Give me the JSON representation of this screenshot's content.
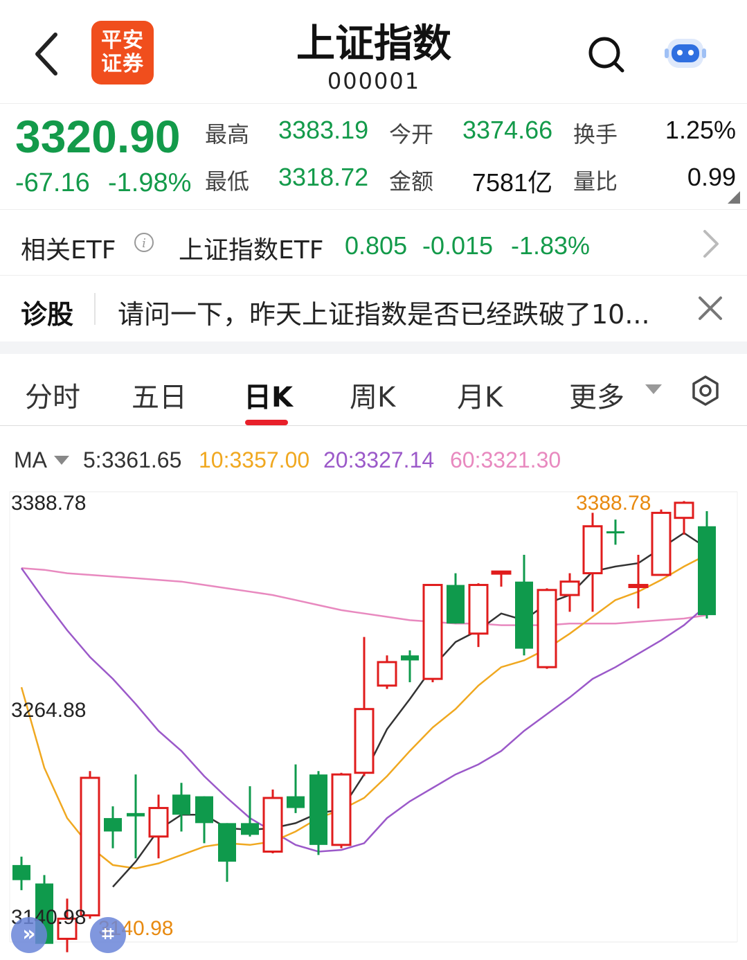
{
  "header": {
    "title": "上证指数",
    "code": "000001",
    "logo_line1": "平安",
    "logo_line2": "证券"
  },
  "quote": {
    "price": "3320.90",
    "change": "-67.16",
    "change_pct": "-1.98%",
    "fields": [
      {
        "label": "最高",
        "value": "3383.19"
      },
      {
        "label": "今开",
        "value": "3374.66"
      },
      {
        "label": "换手",
        "value": "1.25%"
      },
      {
        "label": "最低",
        "value": "3318.72"
      },
      {
        "label": "金额",
        "value": "7581亿"
      },
      {
        "label": "量比",
        "value": "0.99"
      }
    ]
  },
  "etf": {
    "label": "相关ETF",
    "name": "上证指数ETF",
    "price": "0.805",
    "change": "-0.015",
    "change_pct": "-1.83%"
  },
  "diagnose": {
    "label": "诊股",
    "text": "请问一下，昨天上证指数是否已经跌破了10..."
  },
  "tabs": [
    "分时",
    "五日",
    "日K",
    "周K",
    "月K",
    "更多"
  ],
  "active_tab": "日K",
  "ma": {
    "label": "MA",
    "ma5": "5:3361.65",
    "ma10": "10:3357.00",
    "ma20": "20:3327.14",
    "ma60": "60:3321.30"
  },
  "colors": {
    "up": "#e01c1c",
    "down": "#0f9a4c",
    "ma5": "#333333",
    "ma10": "#f0a820",
    "ma20": "#9b59c9",
    "ma60": "#e889bf",
    "accent": "#e8202a"
  },
  "chart_data": {
    "type": "candlestick",
    "y_axis_labels": [
      "3388.78",
      "3264.88",
      "3140.98"
    ],
    "ylim": [
      3140.98,
      3388.78
    ],
    "max_label": "3388.78",
    "min_label": "3140.98",
    "candles": [
      {
        "o": 3172,
        "c": 3163,
        "h": 3177,
        "l": 3157
      },
      {
        "o": 3161,
        "c": 3125,
        "h": 3166,
        "l": 3125
      },
      {
        "o": 3128,
        "c": 3140,
        "h": 3152,
        "l": 3120
      },
      {
        "o": 3142,
        "c": 3224,
        "h": 3228,
        "l": 3140
      },
      {
        "o": 3200,
        "c": 3192,
        "h": 3207,
        "l": 3182
      },
      {
        "o": 3203,
        "c": 3201,
        "h": 3226,
        "l": 3176
      },
      {
        "o": 3189,
        "c": 3206,
        "h": 3214,
        "l": 3176
      },
      {
        "o": 3214,
        "c": 3202,
        "h": 3221,
        "l": 3192
      },
      {
        "o": 3213,
        "c": 3197,
        "h": 3213,
        "l": 3185
      },
      {
        "o": 3197,
        "c": 3174,
        "h": 3197,
        "l": 3162
      },
      {
        "o": 3197,
        "c": 3190,
        "h": 3219,
        "l": 3189
      },
      {
        "o": 3180,
        "c": 3212,
        "h": 3217,
        "l": 3179
      },
      {
        "o": 3213,
        "c": 3206,
        "h": 3232,
        "l": 3203
      },
      {
        "o": 3226,
        "c": 3184,
        "h": 3228,
        "l": 3178
      },
      {
        "o": 3184,
        "c": 3226,
        "h": 3227,
        "l": 3182
      },
      {
        "o": 3227,
        "c": 3265,
        "h": 3308,
        "l": 3225
      },
      {
        "o": 3279,
        "c": 3293,
        "h": 3297,
        "l": 3277
      },
      {
        "o": 3297,
        "c": 3294,
        "h": 3300,
        "l": 3281
      },
      {
        "o": 3283,
        "c": 3339,
        "h": 3339,
        "l": 3281
      },
      {
        "o": 3339,
        "c": 3316,
        "h": 3346,
        "l": 3316
      },
      {
        "o": 3310,
        "c": 3339,
        "h": 3340,
        "l": 3302
      },
      {
        "o": 3346,
        "c": 3347,
        "h": 3347,
        "l": 3338
      },
      {
        "o": 3341,
        "c": 3301,
        "h": 3357,
        "l": 3297
      },
      {
        "o": 3290,
        "c": 3336,
        "h": 3337,
        "l": 3289
      },
      {
        "o": 3333,
        "c": 3341,
        "h": 3346,
        "l": 3323
      },
      {
        "o": 3346,
        "c": 3374,
        "h": 3382,
        "l": 3323
      },
      {
        "o": 3371,
        "c": 3370,
        "h": 3378,
        "l": 3363
      },
      {
        "o": 3338,
        "c": 3339,
        "h": 3357,
        "l": 3325
      },
      {
        "o": 3345,
        "c": 3382,
        "h": 3384,
        "l": 3345
      },
      {
        "o": 3379,
        "c": 3388,
        "h": 3389,
        "l": 3369
      },
      {
        "o": 3374,
        "c": 3321,
        "h": 3383,
        "l": 3319
      }
    ],
    "ma5_values": [
      null,
      null,
      null,
      null,
      3159,
      3174,
      3193,
      3202,
      3202,
      3194,
      3193,
      3194,
      3197,
      3203,
      3205,
      3226,
      3253,
      3271,
      3290,
      3305,
      3312,
      3322,
      3318,
      3328,
      3333,
      3347,
      3350,
      3352,
      3361,
      3370,
      3361
    ],
    "ma10_values": [
      3278,
      3230,
      3200,
      3183,
      3172,
      3170,
      3173,
      3178,
      3183,
      3185,
      3184,
      3186,
      3192,
      3200,
      3205,
      3212,
      3225,
      3240,
      3254,
      3265,
      3279,
      3290,
      3294,
      3301,
      3310,
      3320,
      3330,
      3335,
      3342,
      3350,
      3357
    ],
    "ma20_values": [
      3349,
      3330,
      3312,
      3296,
      3283,
      3268,
      3252,
      3240,
      3225,
      3212,
      3200,
      3192,
      3184,
      3180,
      3181,
      3185,
      3200,
      3210,
      3218,
      3226,
      3232,
      3240,
      3252,
      3262,
      3272,
      3283,
      3290,
      3298,
      3306,
      3315,
      3327
    ],
    "ma60_values": [
      3349,
      3348,
      3346,
      3345,
      3344,
      3343,
      3342,
      3341,
      3339,
      3337,
      3335,
      3333,
      3330,
      3327,
      3324,
      3322,
      3320,
      3318,
      3317,
      3316,
      3316,
      3315,
      3315,
      3315,
      3316,
      3316,
      3316,
      3317,
      3318,
      3319,
      3321
    ]
  }
}
